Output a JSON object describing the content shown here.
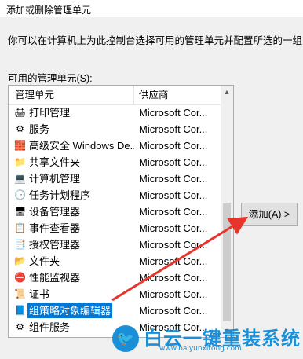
{
  "dialog": {
    "title": "添加或删除管理单元",
    "description": "你可以在计算机上为此控制台选择可用的管理单元并配置所选的一组管",
    "available_label": "可用的管理单元(S):"
  },
  "list": {
    "header_name": "管理单元",
    "header_vendor": "供应商",
    "items": [
      {
        "name": "打印管理",
        "vendor": "Microsoft Cor...",
        "icon": "printer-icon",
        "glyph": "🖨"
      },
      {
        "name": "服务",
        "vendor": "Microsoft Cor...",
        "icon": "gear-icon",
        "glyph": "⚙"
      },
      {
        "name": "高级安全 Windows De...",
        "vendor": "Microsoft Cor...",
        "icon": "firewall-icon",
        "glyph": "🧱"
      },
      {
        "name": "共享文件夹",
        "vendor": "Microsoft Cor...",
        "icon": "shared-folder-icon",
        "glyph": "📁"
      },
      {
        "name": "计算机管理",
        "vendor": "Microsoft Cor...",
        "icon": "computer-management-icon",
        "glyph": "💻"
      },
      {
        "name": "任务计划程序",
        "vendor": "Microsoft Cor...",
        "icon": "clock-icon",
        "glyph": "🕒"
      },
      {
        "name": "设备管理器",
        "vendor": "Microsoft Cor...",
        "icon": "device-icon",
        "glyph": "🖥"
      },
      {
        "name": "事件查看器",
        "vendor": "Microsoft Cor...",
        "icon": "event-viewer-icon",
        "glyph": "📋"
      },
      {
        "name": "授权管理器",
        "vendor": "Microsoft Cor...",
        "icon": "authorization-icon",
        "glyph": "📑"
      },
      {
        "name": "文件夹",
        "vendor": "Microsoft Cor...",
        "icon": "folder-icon",
        "glyph": "📂"
      },
      {
        "name": "性能监视器",
        "vendor": "Microsoft Cor...",
        "icon": "performance-icon",
        "glyph": "⛔"
      },
      {
        "name": "证书",
        "vendor": "Microsoft Cor...",
        "icon": "certificate-icon",
        "glyph": "📜"
      },
      {
        "name": "组策略对象编辑器",
        "vendor": "Microsoft Cor...",
        "icon": "policy-icon",
        "glyph": "📘",
        "selected": true
      },
      {
        "name": "组件服务",
        "vendor": "Microsoft Cor...",
        "icon": "component-services-icon",
        "glyph": "⚙"
      }
    ]
  },
  "buttons": {
    "add_label": "添加(A) >"
  },
  "watermark": {
    "title": "白云一键重装系统",
    "url": "www.baiyunxitong.com",
    "logo_glyph": "🐦"
  },
  "colors": {
    "selection": "#0078d7",
    "arrow": "#e8352b",
    "watermark": "#1a8fd8"
  }
}
